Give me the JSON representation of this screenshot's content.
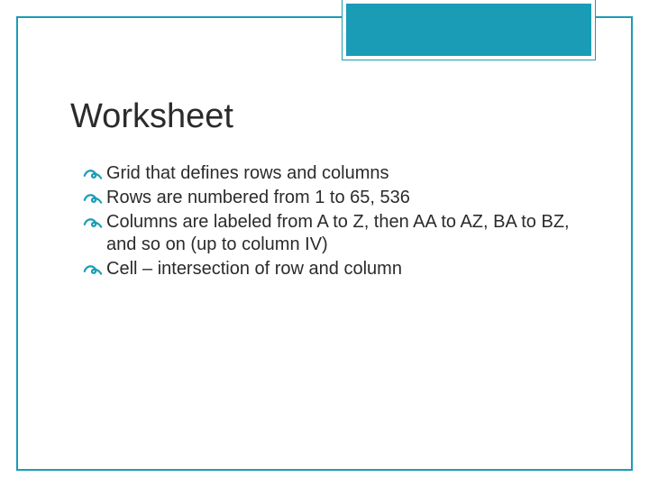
{
  "title": "Worksheet",
  "bullets": [
    "Grid that defines rows and columns",
    "Rows are numbered from 1 to 65, 536",
    "Columns are labeled from A to Z, then AA to AZ, BA to BZ, and so on (up to column IV)",
    "Cell – intersection of row and column"
  ],
  "colors": {
    "accent": "#1a9cb7",
    "text": "#2b2b2b"
  }
}
